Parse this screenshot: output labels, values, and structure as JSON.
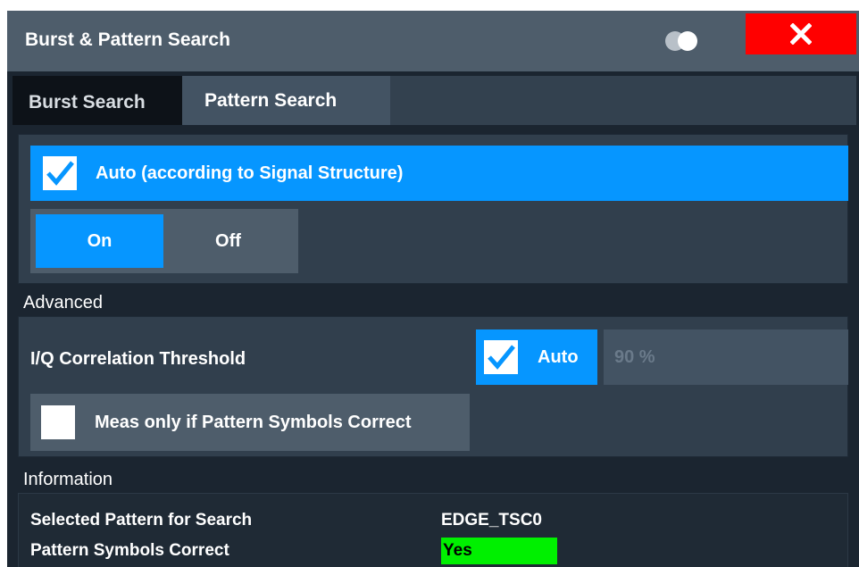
{
  "dialog": {
    "title": "Burst & Pattern Search",
    "icons": {
      "toggle": "display-toggle-icon",
      "close": "close-icon"
    },
    "colors": {
      "accent": "#0696ff",
      "close": "#ff0000",
      "status_ok": "#00f000"
    }
  },
  "tabs": [
    {
      "label": "Burst Search",
      "active": false
    },
    {
      "label": "Pattern Search",
      "active": true
    }
  ],
  "auto": {
    "label": "Auto (according to Signal Structure)",
    "checked": true,
    "on_label": "On",
    "off_label": "Off",
    "selected": "On"
  },
  "advanced": {
    "heading": "Advanced",
    "iq_label": "I/Q Correlation Threshold",
    "iq_auto_label": "Auto",
    "iq_auto_checked": true,
    "iq_value": "90 %",
    "meas_label": "Meas only if Pattern Symbols Correct",
    "meas_checked": false
  },
  "information": {
    "heading": "Information",
    "rows": [
      {
        "label": "Selected Pattern for Search",
        "value": "EDGE_TSC0"
      },
      {
        "label": "Pattern Symbols Correct",
        "value": "Yes"
      }
    ]
  }
}
